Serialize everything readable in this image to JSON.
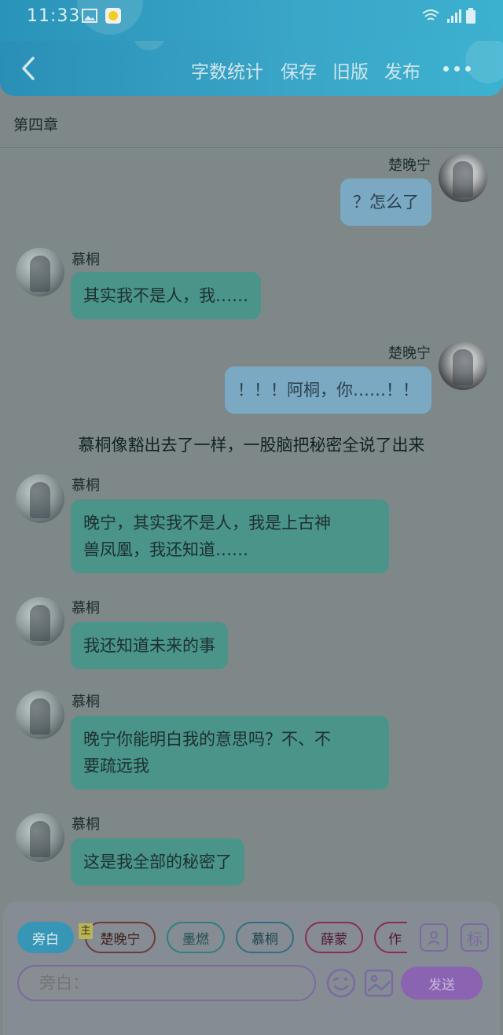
{
  "status_bar": {
    "time": "11:33",
    "icons": [
      "image-icon",
      "chat-app-icon",
      "wifi-icon",
      "signal-icon",
      "battery-icon"
    ]
  },
  "header": {
    "back_icon": "chevron-left-icon",
    "actions": {
      "word_count": "字数统计",
      "save": "保存",
      "old_version": "旧版",
      "publish": "发布"
    },
    "more_icon": "more-dots-icon"
  },
  "chapter": {
    "title": "第四章"
  },
  "messages": [
    {
      "side": "right",
      "name": "楚晚宁",
      "text": "？怎么了"
    },
    {
      "side": "left",
      "name": "慕桐",
      "text": "其实我不是人，我……"
    },
    {
      "side": "right",
      "name": "楚晚宁",
      "text": "！！！阿桐，你……！！"
    },
    {
      "side": "narration",
      "text": "慕桐像豁出去了一样，一股脑把秘密全说了出来"
    },
    {
      "side": "left",
      "name": "慕桐",
      "line1": "晚宁，其实我不是人，我是上古神",
      "line2": "兽凤凰，我还知道……"
    },
    {
      "side": "left",
      "name": "慕桐",
      "text": "我还知道未来的事"
    },
    {
      "side": "left",
      "name": "慕桐",
      "line1": "晚宁你能明白我的意思吗？不、不",
      "line2": "要疏远我"
    },
    {
      "side": "left",
      "name": "慕桐",
      "text": "这是我全部的秘密了"
    }
  ],
  "composer": {
    "main_tag": "主",
    "chips": [
      "旁白",
      "楚晚宁",
      "墨燃",
      "慕桐",
      "薛蒙",
      "作"
    ],
    "chip_colors": [
      "#3795b5",
      "#6b3a3a",
      "#2f7f82",
      "#2f6f82",
      "#8a2d55",
      "#8a2d55"
    ],
    "side_icons": {
      "character": "person-card-icon",
      "tag": "标"
    },
    "input_placeholder": "旁白：",
    "emoji_icon": "smiley-icon",
    "image_icon": "image-icon",
    "send_label": "发送"
  }
}
